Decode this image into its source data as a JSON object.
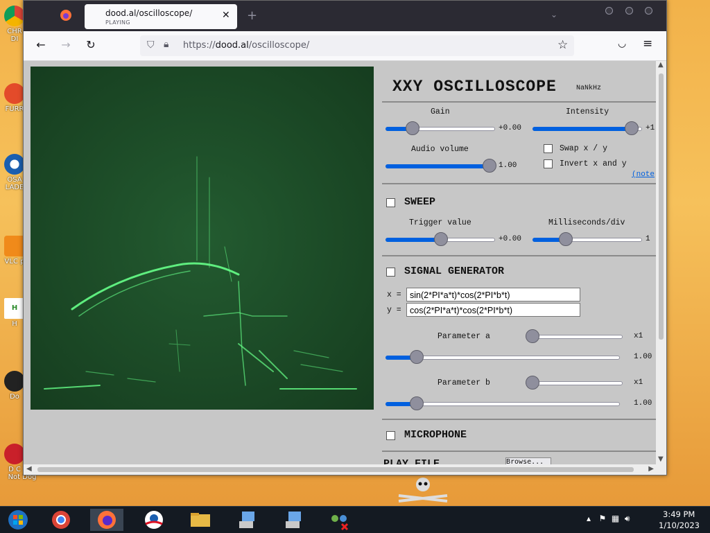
{
  "desktop": {
    "icons": [
      "CHR DI",
      "FURR",
      "OSA LADE",
      "VLC p",
      "H",
      "Do",
      "D C",
      "Not Dog"
    ]
  },
  "browser": {
    "tab": {
      "title": "dood.al/oscilloscope/",
      "status": "PLAYING"
    },
    "url_prefix": "https://",
    "url_domain": "dood.al",
    "url_path": "/oscilloscope/"
  },
  "panel": {
    "title": "XXY OSCILLOSCOPE",
    "frequency": "NaNkHz",
    "gain": {
      "label": "Gain",
      "value_text": "+0.00",
      "fraction": 0.24
    },
    "intensity": {
      "label": "Intensity",
      "value_text": "+1",
      "fraction": 0.9
    },
    "audio_volume": {
      "label": "Audio volume",
      "value_text": "1.00",
      "fraction": 0.98
    },
    "swap_xy": {
      "label": "Swap x / y",
      "checked": false
    },
    "invert_xy": {
      "label": "Invert x and y",
      "checked": false
    },
    "note_link": "(note",
    "sweep": {
      "label": "SWEEP",
      "trigger": {
        "label": "Trigger value",
        "value_text": "+0.00",
        "fraction": 0.5
      },
      "ms_div": {
        "label": "Milliseconds/div",
        "value_text": "1",
        "fraction": 0.3
      }
    },
    "signal_generator": {
      "label": "SIGNAL GENERATOR",
      "x_label": "x =",
      "x_expr": "sin(2*PI*a*t)*cos(2*PI*b*t)",
      "y_label": "y =",
      "y_expr": "cos(2*PI*a*t)*cos(2*PI*b*t)",
      "param_a": {
        "label": "Parameter a",
        "mult_text": "x1",
        "value_text": "1.00"
      },
      "param_b": {
        "label": "Parameter b",
        "mult_text": "x1",
        "value_text": "1.00"
      }
    },
    "microphone": {
      "label": "MICROPHONE"
    },
    "play_file": {
      "label": "PLAY FILE",
      "button": "Browse..."
    }
  },
  "taskbar": {
    "time": "3:49 PM",
    "date": "1/10/2023"
  },
  "colors": {
    "scope_bg": "#1c4a26",
    "trace": "#66ff88",
    "slider_fill": "#0060df",
    "tabbar": "#2b2a33",
    "taskbar": "#141a22"
  }
}
